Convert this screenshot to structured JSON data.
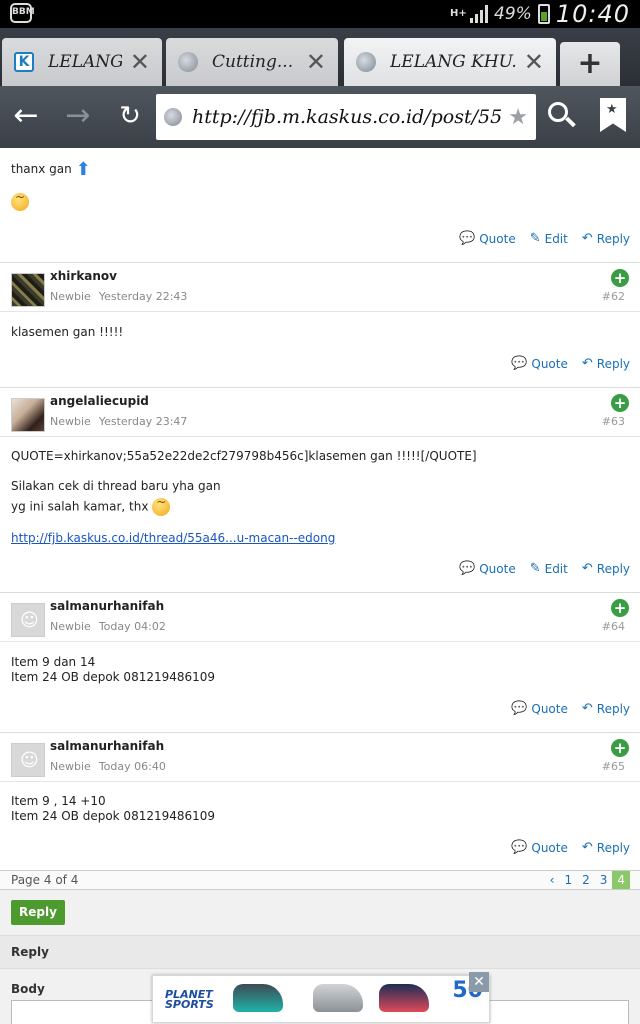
{
  "status_bar": {
    "network": "H+",
    "battery_percent": "49%",
    "time": "10:40"
  },
  "tabs": [
    {
      "title": "LELANG...",
      "favicon": "kaskus-icon"
    },
    {
      "title": "Cutting...",
      "favicon": "globe-icon"
    },
    {
      "title": "LELANG KHU...",
      "favicon": "globe-icon",
      "active": true
    }
  ],
  "url_bar": {
    "url": "http://fjb.m.kaskus.co.id/post/55"
  },
  "top_post": {
    "text": "thanx gan"
  },
  "posts": [
    {
      "username": "xhirkanov",
      "role": "Newbie",
      "time": "Yesterday 22:43",
      "number": "#62",
      "text": "klasemen gan !!!!!"
    },
    {
      "username": "angelaliecupid",
      "role": "Newbie",
      "time": "Yesterday 23:47",
      "number": "#63",
      "quote_line": "QUOTE=xhirkanov;55a52e22de2cf279798b456c]klasemen gan !!!!![/QUOTE]",
      "line2": "Silakan cek di thread baru yha gan",
      "line3": "yg ini salah kamar, thx",
      "link": "http://fjb.kaskus.co.id/thread/55a46...u-macan--edong"
    },
    {
      "username": "salmanurhanifah",
      "role": "Newbie",
      "time": "Today 04:02",
      "number": "#64",
      "line1": "Item 9 dan 14",
      "line2": "Item 24 OB depok 081219486109"
    },
    {
      "username": "salmanurhanifah",
      "role": "Newbie",
      "time": "Today 06:40",
      "number": "#65",
      "line1": "Item 9 , 14 +10",
      "line2": "Item 24 OB depok 081219486109"
    }
  ],
  "actions": {
    "quote": "Quote",
    "edit": "Edit",
    "reply": "Reply"
  },
  "pagination": {
    "label": "Page 4 of 4",
    "prev": "‹",
    "pages": [
      "1",
      "2",
      "3",
      "4"
    ],
    "current": "4"
  },
  "reply_form": {
    "button": "Reply",
    "heading": "Reply",
    "body_label": "Body"
  },
  "ad": {
    "brand_line1": "PLANET",
    "brand_line2": "SPORTS",
    "sale_text": "50"
  },
  "colors": {
    "link": "#1a6fb5",
    "green": "#3a9c45",
    "toolbar": "#3b4047"
  }
}
